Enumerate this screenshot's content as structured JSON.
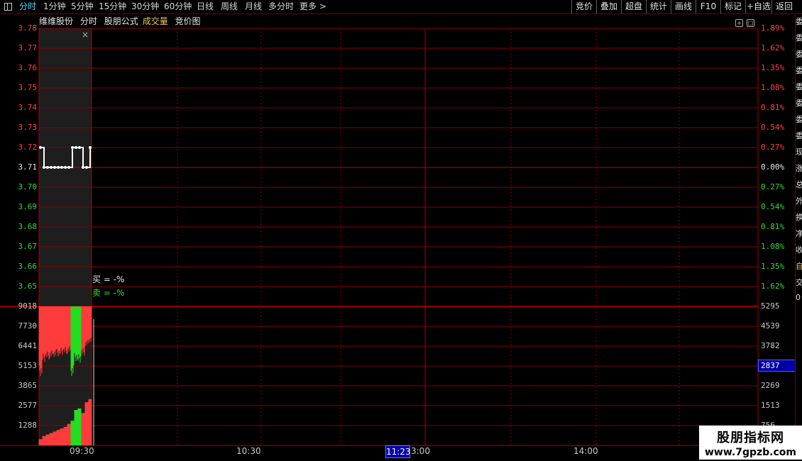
{
  "toolbar": {
    "tabs": [
      "分时",
      "1分钟",
      "5分钟",
      "15分钟",
      "30分钟",
      "60分钟",
      "日线",
      "周线",
      "月线",
      "多分时",
      "更多"
    ],
    "right_buttons": [
      "竞价",
      "叠加",
      "超盘",
      "统计",
      "画线",
      "F10",
      "标记",
      "+自选",
      "返回"
    ]
  },
  "title": {
    "stock": "维维股份",
    "period": "分时",
    "formula": "股朋公式",
    "indicator": "成交量",
    "chart_name": "竞价图"
  },
  "price_axis": {
    "left": [
      "3.78",
      "3.77",
      "3.76",
      "3.75",
      "3.74",
      "3.73",
      "3.72",
      "3.71",
      "3.70",
      "3.69",
      "3.68",
      "3.67",
      "3.66",
      "3.65"
    ],
    "right": [
      "1.89%",
      "1.62%",
      "1.35%",
      "1.08%",
      "0.81%",
      "0.54%",
      "0.27%",
      "0.00%",
      "0.27%",
      "0.54%",
      "0.81%",
      "1.08%",
      "1.35%",
      "1.62%"
    ]
  },
  "volume_axis": {
    "left": [
      "9018",
      "7730",
      "6441",
      "5153",
      "3865",
      "2577",
      "1288"
    ],
    "right": [
      "5295",
      "4539",
      "3782",
      "",
      "2269",
      "1513",
      "756"
    ],
    "cursor_value": "2837"
  },
  "time_axis": {
    "labels": [
      "09:30",
      "10:30",
      "3:00",
      "14:00"
    ],
    "cursor": "11:23"
  },
  "buy_sell": {
    "buy": "买 = -%",
    "sell": "卖 = -%"
  },
  "side_strip": [
    "委",
    "委",
    "委",
    "委",
    "委",
    "委",
    "委",
    "委",
    "现",
    "涨",
    "总",
    "外",
    "换",
    "净",
    "收",
    "自",
    "交",
    "0"
  ],
  "watermark": {
    "title": "股朋指标网",
    "url": "www.7gpzb.com"
  },
  "colors": {
    "grid": "#8a0000",
    "up": "#ff3b3b",
    "down": "#22dd22",
    "price_line": "#ffffff",
    "cursor_bg": "#0000b0"
  },
  "chart_data": {
    "type": "line",
    "auction_price": {
      "values": [
        3.72,
        3.71,
        3.71,
        3.71,
        3.71,
        3.71,
        3.71,
        3.71,
        3.71,
        3.72,
        3.72,
        3.72,
        3.71,
        3.71,
        3.72
      ]
    },
    "auction_volume": {
      "values": [
        9018,
        7200,
        6900,
        6700,
        6600,
        6500,
        6300,
        6200,
        6100,
        9018,
        7100,
        7300,
        6400,
        5200,
        4700
      ],
      "up": [
        true,
        true,
        true,
        true,
        true,
        true,
        true,
        true,
        true,
        false,
        false,
        false,
        true,
        true,
        true
      ]
    },
    "bottom_volume": {
      "values": [
        400,
        600,
        700,
        800,
        900,
        1000,
        1100,
        1200,
        1400,
        1600,
        2300,
        2400,
        2100,
        2800,
        3000
      ],
      "up": [
        true,
        true,
        true,
        true,
        true,
        true,
        true,
        true,
        true,
        false,
        false,
        false,
        true,
        true,
        true
      ]
    },
    "price_ylim": [
      3.64,
      3.78
    ],
    "volume_ylim": [
      0,
      9018
    ]
  }
}
